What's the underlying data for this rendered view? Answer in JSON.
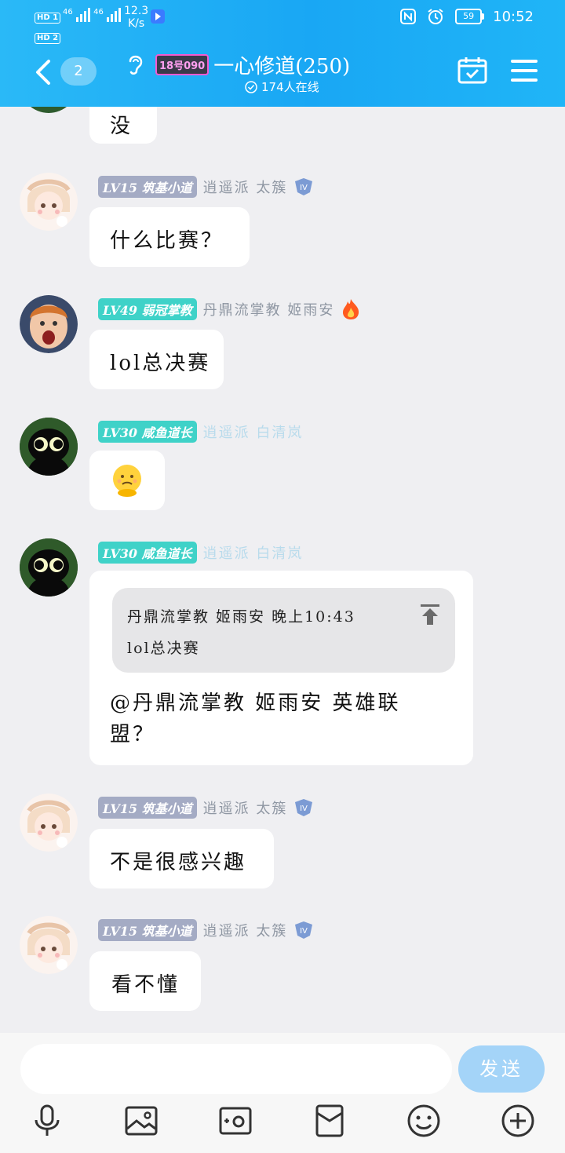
{
  "status": {
    "sim1": "HD 1",
    "sim2": "HD 2",
    "net1": "46",
    "net2": "46",
    "speed_value": "12.3",
    "speed_unit": "K/s",
    "battery": "59",
    "time": "10:52"
  },
  "header": {
    "unread_count": "2",
    "group_tag": "18号090",
    "title": "一心修道(250)",
    "online": "174人在线"
  },
  "messages": [
    {
      "text": "没"
    },
    {
      "level": "LV15 筑基小道",
      "nick": "逍遥派 太簇",
      "text": "什么比赛？"
    },
    {
      "level": "LV49 弱冠掌教",
      "nick": "丹鼎流掌教 姬雨安",
      "text": "lol总决赛"
    },
    {
      "level": "LV30 咸鱼道长",
      "nick": "逍遥派 白清岚",
      "text": "🙁"
    },
    {
      "level": "LV30 咸鱼道长",
      "nick": "逍遥派 白清岚",
      "quote_header": "丹鼎流掌教 姬雨安 晚上10:43",
      "quote_text": "lol总决赛",
      "text_line1": "@丹鼎流掌教 姬雨安 英雄联",
      "text_line2": "盟？"
    },
    {
      "level": "LV15 筑基小道",
      "nick": "逍遥派 太簇",
      "text": "不是很感兴趣"
    },
    {
      "level": "LV15 筑基小道",
      "nick": "逍遥派 太簇",
      "text": "看不懂"
    }
  ],
  "composer": {
    "send_label": "发送"
  },
  "colors": {
    "header": "#1aa9f4",
    "level_gray": "#a4abc4",
    "level_teal": "#3fd2c8",
    "send": "#a4d4f8"
  }
}
